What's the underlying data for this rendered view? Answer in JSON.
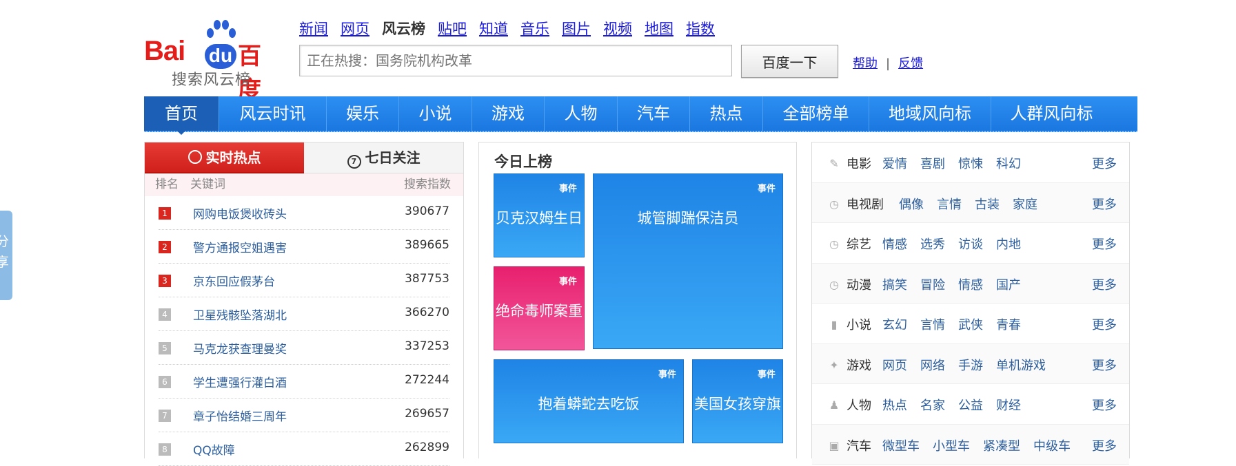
{
  "share": {
    "chars": [
      "分",
      "享"
    ]
  },
  "logo": {
    "word": "Bai",
    "du": "du",
    "cn": "百度",
    "subtitle": "搜索风云榜"
  },
  "topnav": {
    "items": [
      {
        "label": "新闻",
        "current": false
      },
      {
        "label": "网页",
        "current": false
      },
      {
        "label": "风云榜",
        "current": true
      },
      {
        "label": "贴吧",
        "current": false
      },
      {
        "label": "知道",
        "current": false
      },
      {
        "label": "音乐",
        "current": false
      },
      {
        "label": "图片",
        "current": false
      },
      {
        "label": "视频",
        "current": false
      },
      {
        "label": "地图",
        "current": false
      },
      {
        "label": "指数",
        "current": false
      }
    ]
  },
  "search": {
    "placeholder": "正在热搜：国务院机构改革",
    "button": "百度一下"
  },
  "help": {
    "help": "帮助",
    "sep": "|",
    "feedback": "反馈"
  },
  "mainnav": {
    "items": [
      {
        "label": "首页",
        "active": true
      },
      {
        "label": "风云时讯",
        "active": false
      },
      {
        "label": "娱乐",
        "active": false
      },
      {
        "label": "小说",
        "active": false
      },
      {
        "label": "游戏",
        "active": false
      },
      {
        "label": "人物",
        "active": false
      },
      {
        "label": "汽车",
        "active": false
      },
      {
        "label": "热点",
        "active": false
      },
      {
        "label": "全部榜单",
        "active": false
      },
      {
        "label": "地域风向标",
        "active": false
      },
      {
        "label": "人群风向标",
        "active": false
      }
    ]
  },
  "hot": {
    "tab_realtime": "实时热点",
    "tab_realtime_icon": "clock-icon",
    "tab_week": "七日关注",
    "tab_week_icon": "seven-day-icon",
    "col_rank": "排名",
    "col_keyword": "关键词",
    "col_index": "搜索指数",
    "rows": [
      {
        "rank": "1",
        "keyword": "网购电饭煲收砖头",
        "index": "390677"
      },
      {
        "rank": "2",
        "keyword": "警方通报空姐遇害",
        "index": "389665"
      },
      {
        "rank": "3",
        "keyword": "京东回应假茅台",
        "index": "387753"
      },
      {
        "rank": "4",
        "keyword": "卫星残骸坠落湖北",
        "index": "366270"
      },
      {
        "rank": "5",
        "keyword": "马克龙获查理曼奖",
        "index": "337253"
      },
      {
        "rank": "6",
        "keyword": "学生遭强行灌白酒",
        "index": "272244"
      },
      {
        "rank": "7",
        "keyword": "章子怡结婚三周年",
        "index": "269657"
      },
      {
        "rank": "8",
        "keyword": "QQ故障",
        "index": "262899"
      }
    ]
  },
  "today": {
    "title": "今日上榜",
    "tiles": [
      {
        "tag": "事件",
        "title": "贝克汉姆生日",
        "color": "blue"
      },
      {
        "tag": "事件",
        "title": "城管脚踹保洁员",
        "color": "blue"
      },
      {
        "tag": "事件",
        "title": "绝命毒师案重",
        "color": "pink"
      },
      {
        "tag": "事件",
        "title": "抱着蟒蛇去吃饭",
        "color": "blue"
      },
      {
        "tag": "事件",
        "title": "美国女孩穿旗",
        "color": "blue"
      }
    ]
  },
  "categories": {
    "more": "更多",
    "rows": [
      {
        "icon": "film-icon",
        "glyph": "✎",
        "name": "电影",
        "links": [
          "爱情",
          "喜剧",
          "惊悚",
          "科幻"
        ]
      },
      {
        "icon": "tv-icon",
        "glyph": "◷",
        "name": "电视剧",
        "links": [
          "偶像",
          "言情",
          "古装",
          "家庭"
        ]
      },
      {
        "icon": "variety-icon",
        "glyph": "◷",
        "name": "综艺",
        "links": [
          "情感",
          "选秀",
          "访谈",
          "内地"
        ]
      },
      {
        "icon": "anime-icon",
        "glyph": "◷",
        "name": "动漫",
        "links": [
          "搞笑",
          "冒险",
          "情感",
          "国产"
        ]
      },
      {
        "icon": "book-icon",
        "glyph": "▮",
        "name": "小说",
        "links": [
          "玄幻",
          "言情",
          "武侠",
          "青春"
        ]
      },
      {
        "icon": "gamepad-icon",
        "glyph": "✦",
        "name": "游戏",
        "links": [
          "网页",
          "网络",
          "手游",
          "单机游戏"
        ]
      },
      {
        "icon": "person-icon",
        "glyph": "♟",
        "name": "人物",
        "links": [
          "热点",
          "名家",
          "公益",
          "财经"
        ]
      },
      {
        "icon": "car-icon",
        "glyph": "▣",
        "name": "汽车",
        "links": [
          "微型车",
          "小型车",
          "紧凑型",
          "中级车"
        ]
      }
    ]
  }
}
